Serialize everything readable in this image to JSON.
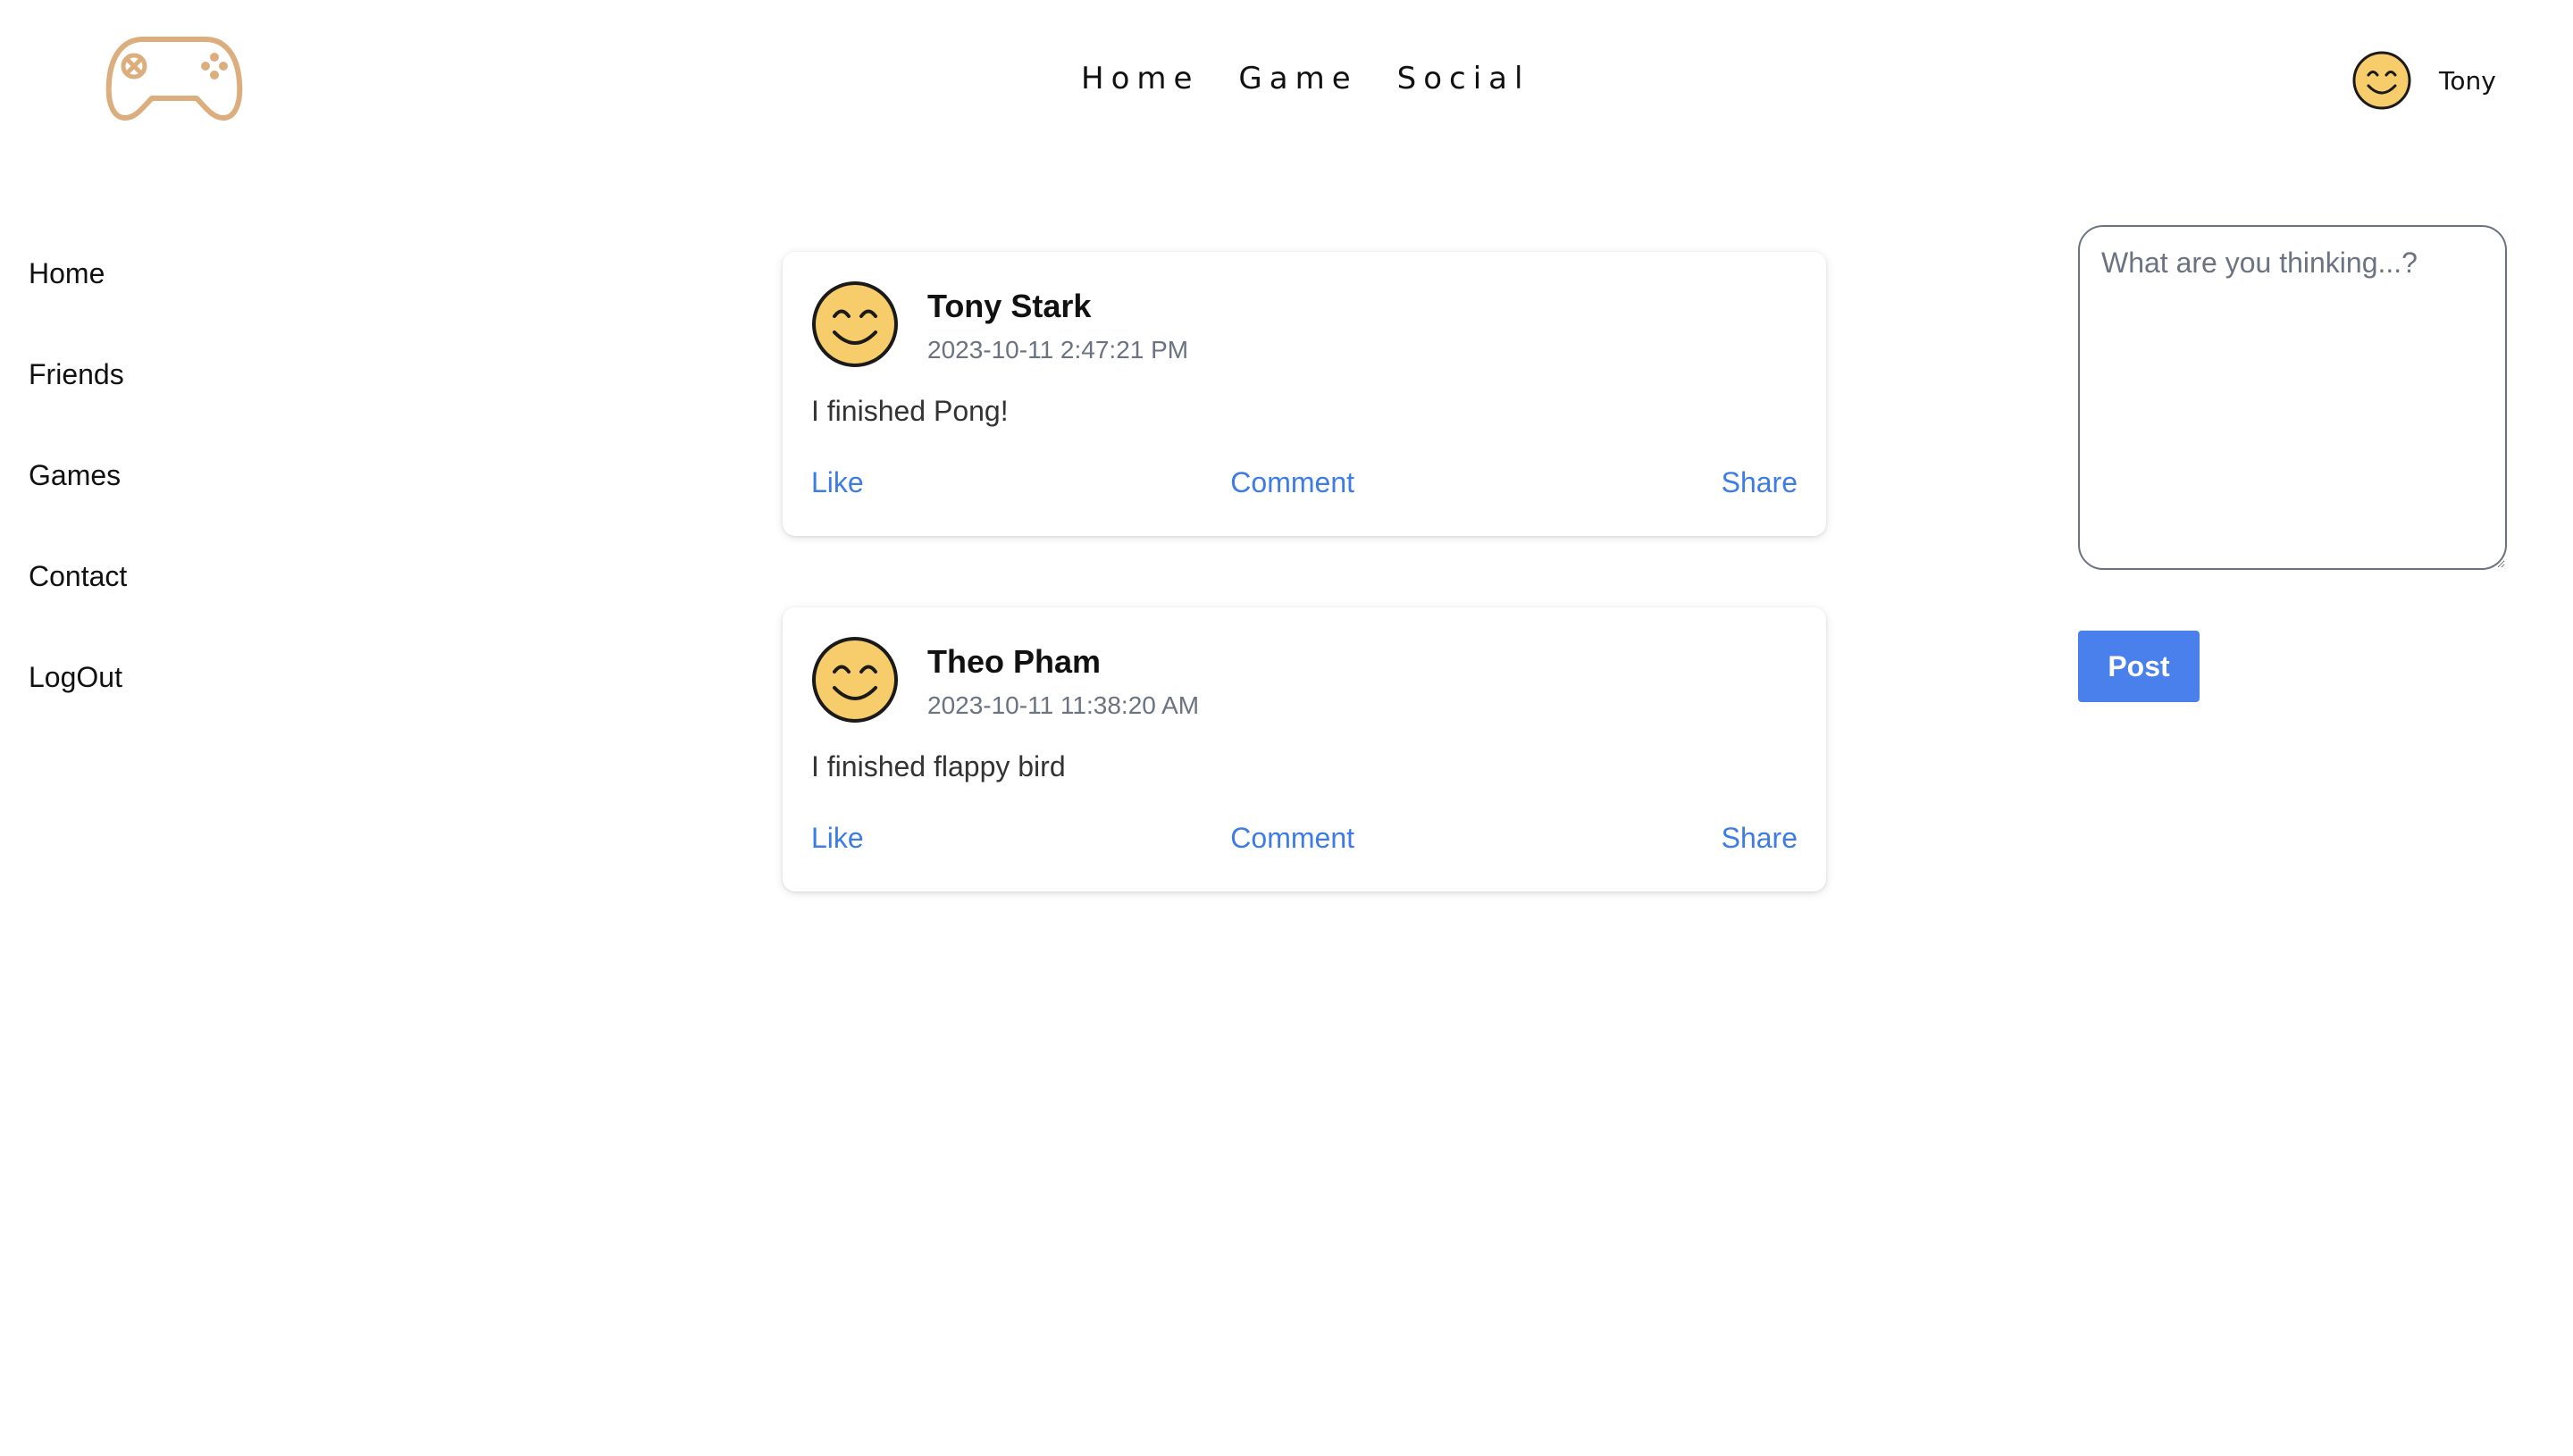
{
  "header": {
    "logo_icon": "gamepad-icon",
    "nav": [
      {
        "label": "Home"
      },
      {
        "label": "Game"
      },
      {
        "label": "Social"
      }
    ],
    "user": {
      "name": "Tony",
      "avatar_icon": "smiley-face-icon"
    }
  },
  "sidebar": {
    "items": [
      {
        "label": "Home"
      },
      {
        "label": "Friends"
      },
      {
        "label": "Games"
      },
      {
        "label": "Contact"
      },
      {
        "label": "LogOut"
      }
    ]
  },
  "feed": {
    "posts": [
      {
        "author": "Tony Stark",
        "timestamp": "2023-10-11 2:47:21 PM",
        "text": "I finished Pong!",
        "actions": {
          "like": "Like",
          "comment": "Comment",
          "share": "Share"
        }
      },
      {
        "author": "Theo Pham",
        "timestamp": "2023-10-11 11:38:20 AM",
        "text": "I finished flappy bird",
        "actions": {
          "like": "Like",
          "comment": "Comment",
          "share": "Share"
        }
      }
    ]
  },
  "composer": {
    "placeholder": "What are you thinking...?",
    "value": "",
    "post_label": "Post"
  },
  "colors": {
    "accent": "#4a80ec",
    "link": "#3d7ce6",
    "logo": "#dcae7d",
    "avatar_fill": "#f7cc6a",
    "muted_text": "#6b7280"
  }
}
